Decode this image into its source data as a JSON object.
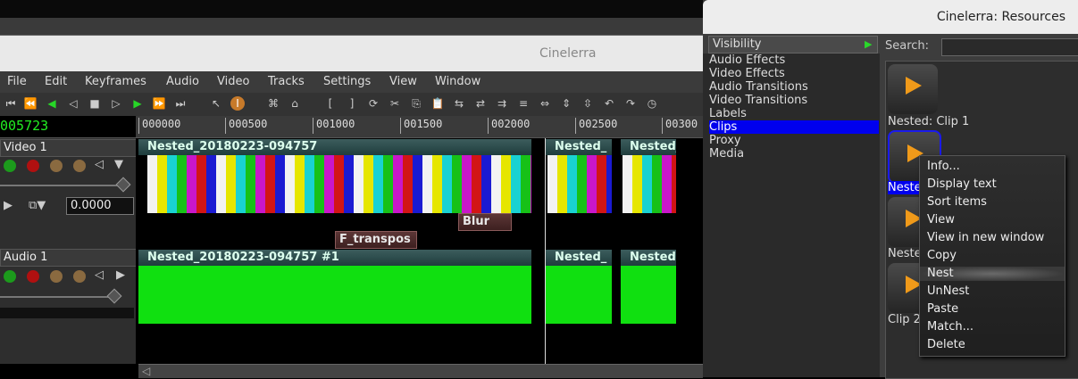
{
  "main_window": {
    "title": "Cinelerra",
    "menu": [
      "File",
      "Edit",
      "Keyframes",
      "Audio",
      "Video",
      "Tracks",
      "Settings",
      "View",
      "Window"
    ],
    "timecode": "005723",
    "ruler_ticks": [
      "000000",
      "000500",
      "001000",
      "001500",
      "002000",
      "002500",
      "00300"
    ],
    "tracks": [
      {
        "name": "Video 1",
        "value": "0.0000"
      },
      {
        "name": "Audio 1"
      }
    ],
    "clips": {
      "video_main": "Nested_20180223-094757",
      "video_b": "Nested_",
      "video_c": "Nested_",
      "audio_main": "Nested_20180223-094757 #1",
      "audio_b": "Nested_",
      "audio_c": "Nested"
    },
    "effects": {
      "blur": "Blur",
      "transpose": "F_transpos"
    }
  },
  "resources": {
    "title": "Cinelerra: Resources",
    "visibility_label": "Visibility",
    "search_label": "Search:",
    "folders": [
      "Audio Effects",
      "Video Effects",
      "Audio Transitions",
      "Video Transitions",
      "Labels",
      "Clips",
      "Proxy",
      "Media"
    ],
    "selected_folder": "Clips",
    "assets": [
      "Nested: Clip 1",
      "Neste",
      "Neste",
      "Clip 2"
    ]
  },
  "context_menu": {
    "items": [
      "Info...",
      "Display text",
      "Sort items",
      "View",
      "View in new window",
      "Copy",
      "Nest",
      "UnNest",
      "Paste",
      "Match...",
      "Delete"
    ],
    "highlighted": "Nest"
  }
}
